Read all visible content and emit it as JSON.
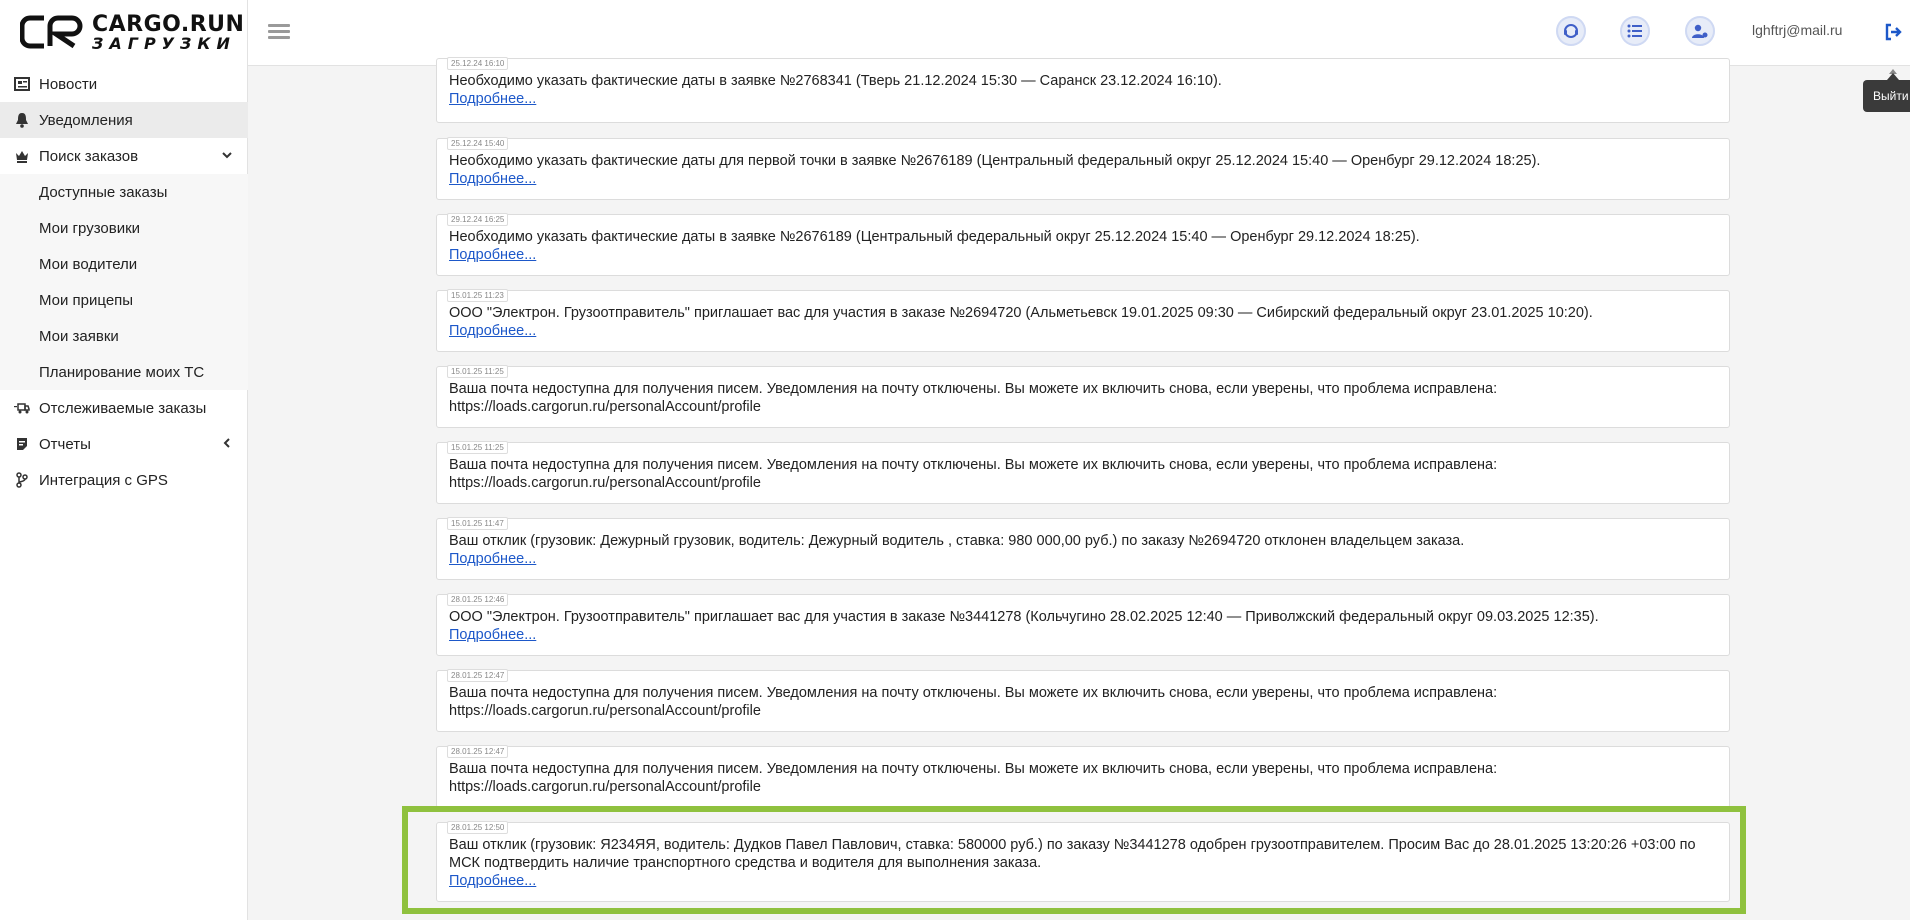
{
  "brand": {
    "name": "CARGO.RUN",
    "sub": "ЗАГРУЗКИ"
  },
  "header": {
    "user_email": "lghftrj@mail.ru",
    "tooltip": "Выйти"
  },
  "sidebar": {
    "items": [
      {
        "label": "Новости",
        "icon": "newspaper-icon"
      },
      {
        "label": "Уведомления",
        "icon": "bell-icon"
      },
      {
        "label": "Поиск заказов",
        "icon": "chess-king-icon"
      },
      {
        "label": "Доступные заказы"
      },
      {
        "label": "Мои грузовики"
      },
      {
        "label": "Мои водители"
      },
      {
        "label": "Мои прицепы"
      },
      {
        "label": "Мои заявки"
      },
      {
        "label": "Планирование моих ТС"
      },
      {
        "label": "Отслеживаемые заказы",
        "icon": "truck-fast-icon"
      },
      {
        "label": "Отчеты",
        "icon": "report-icon"
      },
      {
        "label": "Интеграция с GPS",
        "icon": "branch-icon"
      }
    ]
  },
  "notifications": [
    {
      "time": "25.12.24 16:10",
      "text": "Необходимо указать фактические даты в заявке №2768341 (Тверь 21.12.2024 15:30 — Саранск 23.12.2024 16:10).",
      "more": "Подробнее..."
    },
    {
      "time": "25.12.24 15:40",
      "text": "Необходимо указать фактические даты для первой точки в заявке №2676189 (Центральный федеральный округ 25.12.2024 15:40 — Оренбург 29.12.2024 18:25).",
      "more": "Подробнее..."
    },
    {
      "time": "29.12.24 16:25",
      "text": "Необходимо указать фактические даты в заявке №2676189 (Центральный федеральный округ 25.12.2024 15:40 — Оренбург 29.12.2024 18:25).",
      "more": "Подробнее..."
    },
    {
      "time": "15.01.25 11:23",
      "text": "ООО \"Электрон. Грузоотправитель\" приглашает вас для участия в заказе №2694720 (Альметьевск 19.01.2025 09:30 — Сибирский федеральный округ 23.01.2025 10:20).",
      "more": "Подробнее..."
    },
    {
      "time": "15.01.25 11:25",
      "text": "Ваша почта недоступна для получения писем. Уведомления на почту отключены. Вы можете их включить снова, если уверены, что проблема исправлена: https://loads.cargorun.ru/personalAccount/profile",
      "more": ""
    },
    {
      "time": "15.01.25 11:25",
      "text": "Ваша почта недоступна для получения писем. Уведомления на почту отключены. Вы можете их включить снова, если уверены, что проблема исправлена: https://loads.cargorun.ru/personalAccount/profile",
      "more": ""
    },
    {
      "time": "15.01.25 11:47",
      "text": "Ваш отклик (грузовик: Дежурный грузовик, водитель: Дежурный водитель  , ставка: 980 000,00 руб.) по заказу №2694720 отклонен владельцем заказа.",
      "more": "Подробнее..."
    },
    {
      "time": "28.01.25 12:46",
      "text": "ООО \"Электрон. Грузоотправитель\" приглашает вас для участия в заказе №3441278 (Кольчугино 28.02.2025 12:40 — Приволжский федеральный округ 09.03.2025 12:35).",
      "more": "Подробнее..."
    },
    {
      "time": "28.01.25 12:47",
      "text": "Ваша почта недоступна для получения писем. Уведомления на почту отключены. Вы можете их включить снова, если уверены, что проблема исправлена: https://loads.cargorun.ru/personalAccount/profile",
      "more": ""
    },
    {
      "time": "28.01.25 12:47",
      "text": "Ваша почта недоступна для получения писем. Уведомления на почту отключены. Вы можете их включить снова, если уверены, что проблема исправлена: https://loads.cargorun.ru/personalAccount/profile",
      "more": ""
    },
    {
      "time": "28.01.25 12:50",
      "text": "Ваш отклик (грузовик: Я234ЯЯ, водитель: Дудков Павел Павлович, ставка: 580000 руб.) по заказу №3441278 одобрен грузоотправителем. Просим Вас до 28.01.2025 13:20:26 +03:00 по МСК подтвердить наличие транспортного средства и водителя для выполнения заказа.",
      "more": "Подробнее..."
    }
  ],
  "colors": {
    "accent": "#1d58c9",
    "highlight": "#8fc13e"
  }
}
